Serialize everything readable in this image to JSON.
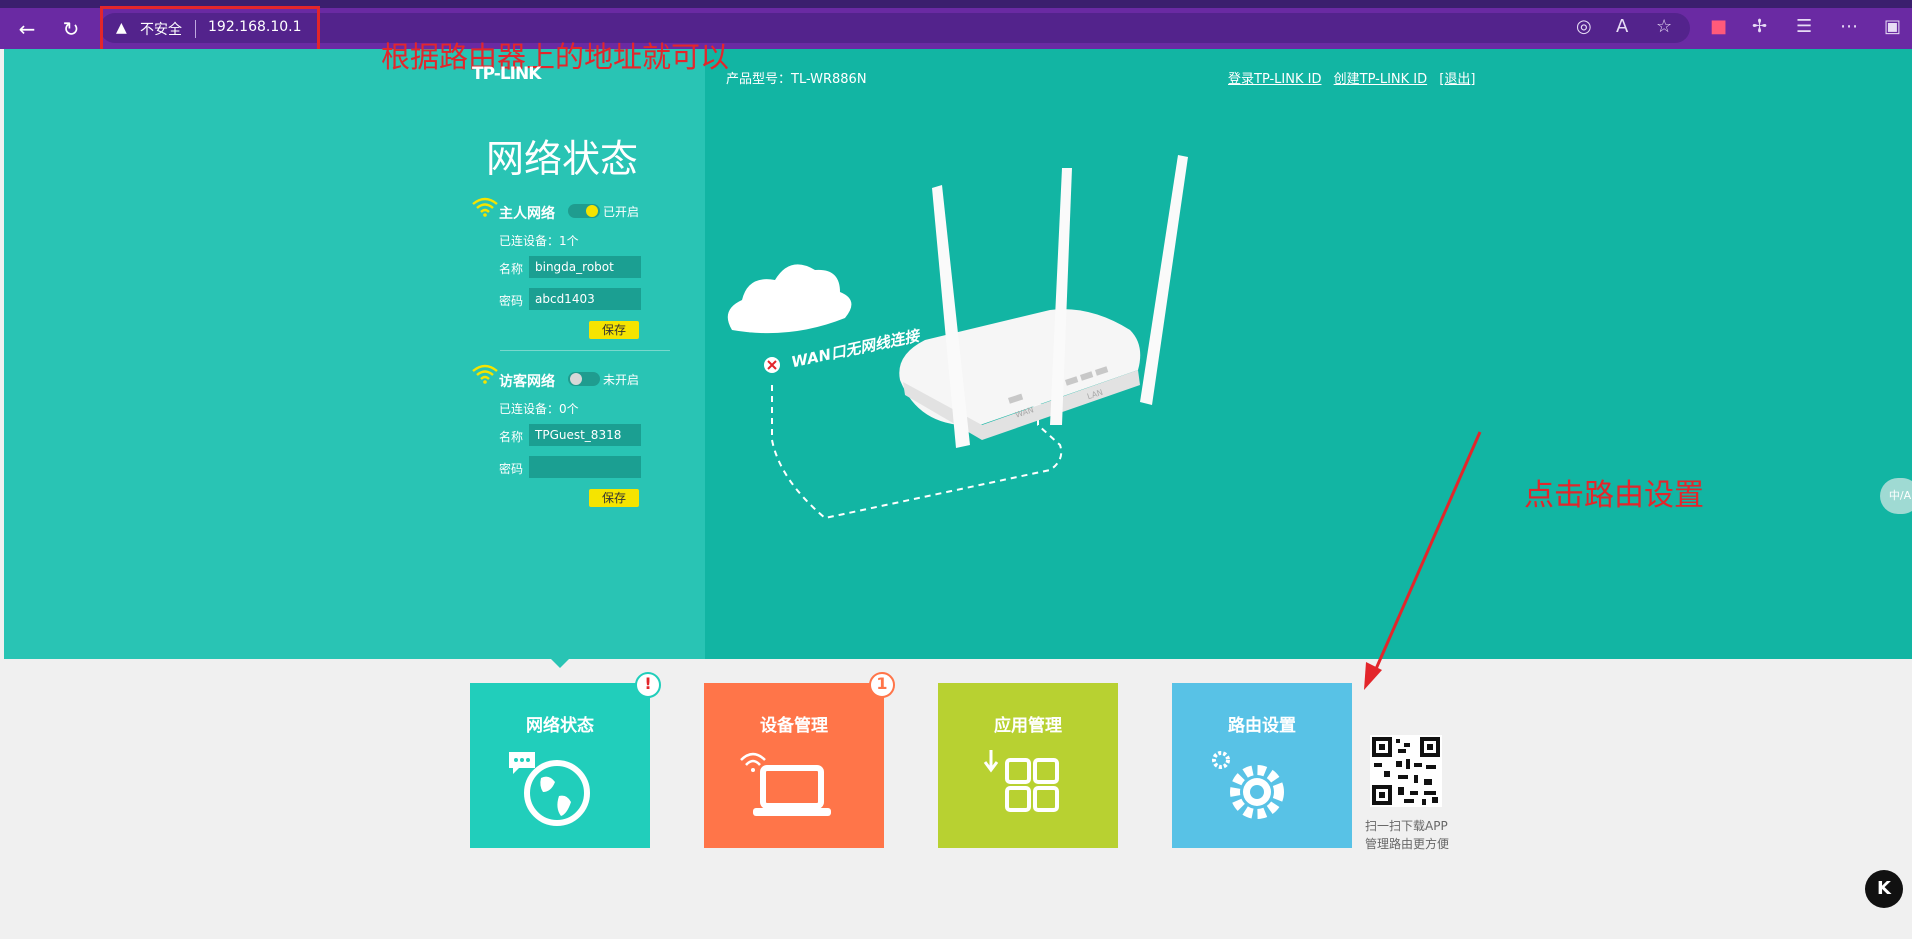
{
  "browser": {
    "security_label": "不安全",
    "url": "192.168.10.1"
  },
  "annotations": {
    "top_note": "根据路由器上的地址就可以",
    "arrow_note": "点击路由设置"
  },
  "header": {
    "brand": "TP-LINK",
    "model": "产品型号：TL-WR886N",
    "links": [
      "登录TP-LINK ID",
      "创建TP-LINK ID",
      "[退出]"
    ]
  },
  "panel": {
    "title": "网络状态",
    "main_network": {
      "label": "主人网络",
      "toggle_state": "已开启",
      "enabled": true,
      "connected": "已连设备：1个",
      "name_label": "名称",
      "name_value": "bingda_robot",
      "pwd_label": "密码",
      "pwd_value": "abcd1403",
      "save": "保存"
    },
    "guest_network": {
      "label": "访客网络",
      "toggle_state": "未开启",
      "enabled": false,
      "connected": "已连设备：0个",
      "name_label": "名称",
      "name_value": "TPGuest_8318",
      "pwd_label": "密码",
      "pwd_value": "",
      "save": "保存"
    }
  },
  "illustration": {
    "cloud": "Internet",
    "status": "WAN口无网线连接",
    "wan_port": "WAN",
    "lan_port": "LAN"
  },
  "tiles": [
    {
      "label": "网络状态",
      "color": "#21cebb",
      "badge": "!",
      "badge_color": "#e3262b"
    },
    {
      "label": "设备管理",
      "color": "#ff7549",
      "badge": "1",
      "badge_color": "#ff7549"
    },
    {
      "label": "应用管理",
      "color": "#b8d131",
      "badge": "",
      "badge_color": ""
    },
    {
      "label": "路由设置",
      "color": "#58c2e6",
      "badge": "",
      "badge_color": ""
    }
  ],
  "qr": {
    "line1": "扫一扫下载APP",
    "line2": "管理路由更方便"
  },
  "side_button": "中/A",
  "corner_button": "K"
}
